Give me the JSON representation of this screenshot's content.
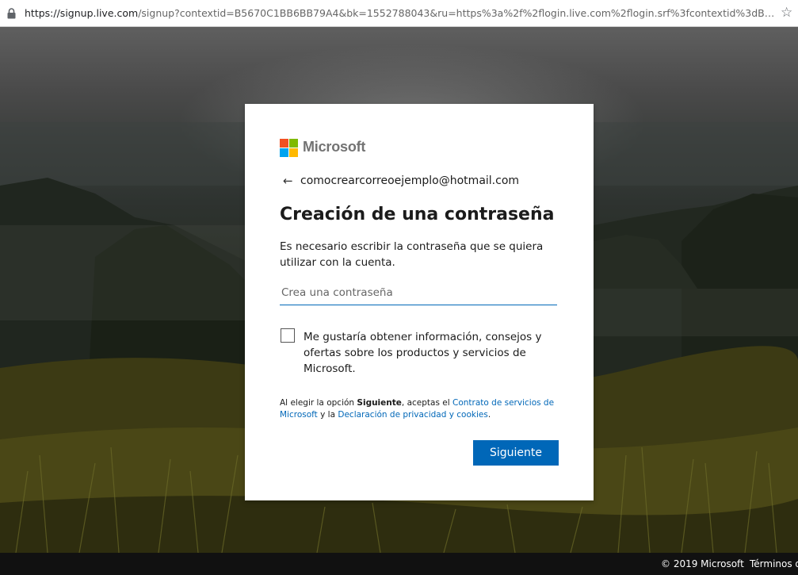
{
  "browser": {
    "url_host": "https://signup.live.com",
    "url_rest": "/signup?contextid=B5670C1BB6BB79A4&bk=1552788043&ru=https%3a%2f%2flogin.live.com%2flogin.srf%3fcontextid%3dB56..."
  },
  "signup": {
    "brand": "Microsoft",
    "logo_colors": [
      "#f25022",
      "#7fba00",
      "#00a4ef",
      "#ffb900"
    ],
    "back_arrow": "←",
    "email": "comocrearcorreoejemplo@hotmail.com",
    "title": "Creación de una contraseña",
    "description": "Es necesario escribir la contraseña que se quiera utilizar con la cuenta.",
    "password_placeholder": "Crea una contraseña",
    "password_value": "",
    "checkbox_checked": false,
    "checkbox_label": "Me gustaría obtener información, consejos y ofertas sobre los productos y servicios de Microsoft.",
    "legal": {
      "part1": "Al elegir la opción ",
      "bold": "Siguiente",
      "part2": ", aceptas el ",
      "link1": "Contrato de servicios de Microsoft",
      "part3": " y la ",
      "link2": "Declaración de privacidad y cookies",
      "part4": "."
    },
    "next_button": "Siguiente"
  },
  "footer": {
    "copyright": "© 2019 Microsoft",
    "terms": "Términos d"
  },
  "colors": {
    "accent": "#0067b8"
  }
}
